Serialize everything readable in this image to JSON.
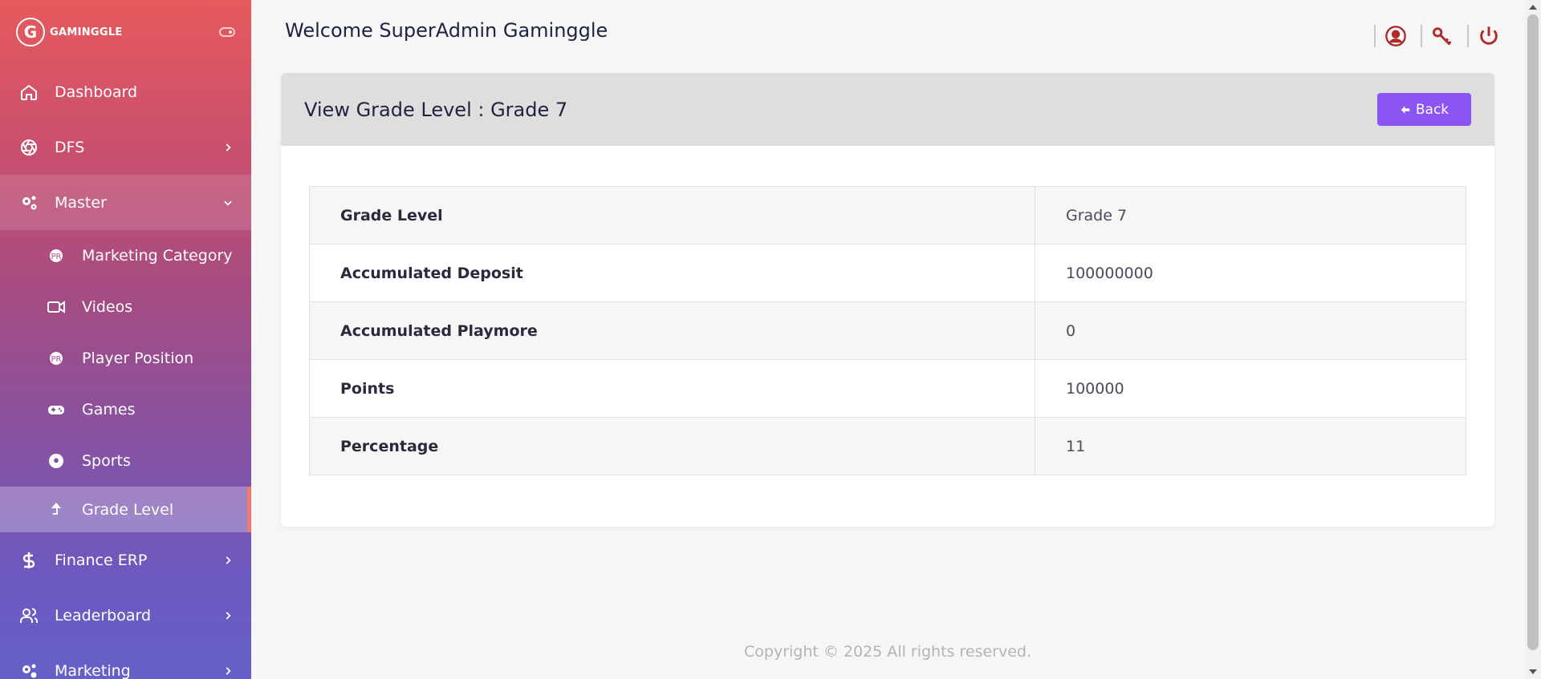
{
  "brand": {
    "name": "GAMINGGLE",
    "mark": "G"
  },
  "sidebar": {
    "items": [
      {
        "label": "Dashboard",
        "icon": "home-icon"
      },
      {
        "label": "DFS",
        "icon": "aperture-icon"
      },
      {
        "label": "Master",
        "icon": "gears-icon"
      }
    ],
    "master_children": [
      {
        "label": "Marketing Category",
        "icon": "badge-icon"
      },
      {
        "label": "Videos",
        "icon": "video-camera-icon"
      },
      {
        "label": "Player Position",
        "icon": "badge-icon"
      },
      {
        "label": "Games",
        "icon": "gamepad-icon"
      },
      {
        "label": "Sports",
        "icon": "soccer-ball-icon"
      },
      {
        "label": "Grade Level",
        "icon": "level-up-icon"
      }
    ],
    "bottom_items": [
      {
        "label": "Finance ERP",
        "icon": "dollar-icon"
      },
      {
        "label": "Leaderboard",
        "icon": "users-icon"
      },
      {
        "label": "Marketing",
        "icon": "gears-icon"
      }
    ]
  },
  "header": {
    "welcome": "Welcome SuperAdmin Gaminggle"
  },
  "card": {
    "title": "View Grade Level : Grade 7",
    "back_label": "Back"
  },
  "details": [
    {
      "key": "Grade Level",
      "value": "Grade 7"
    },
    {
      "key": "Accumulated Deposit",
      "value": "100000000"
    },
    {
      "key": "Accumulated Playmore",
      "value": "0"
    },
    {
      "key": "Points",
      "value": "100000"
    },
    {
      "key": "Percentage",
      "value": "11"
    }
  ],
  "footer": {
    "text": "Copyright © 2025  All rights reserved."
  },
  "colors": {
    "accent": "#8b55f5",
    "header_icon": "#b02a2a",
    "sidebar_top": "#e65a5c",
    "sidebar_bottom": "#6560c9"
  }
}
